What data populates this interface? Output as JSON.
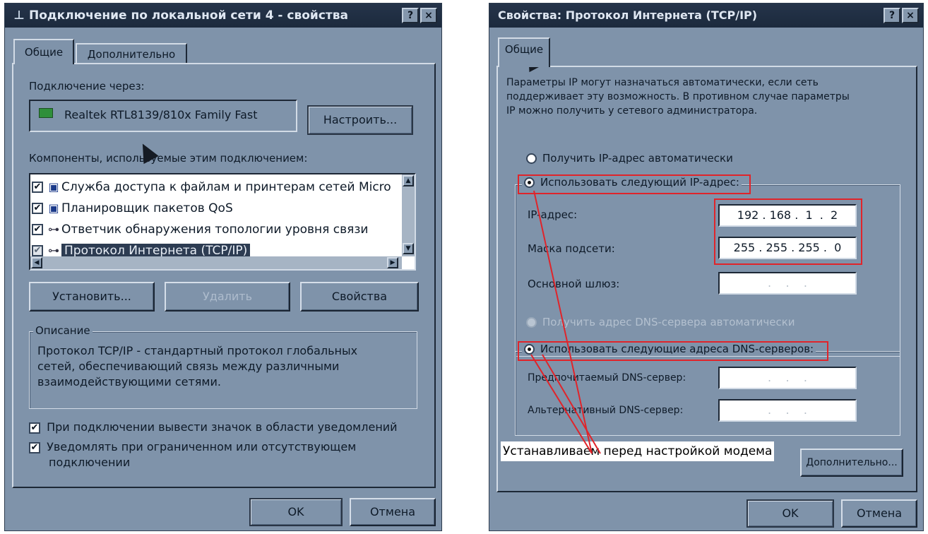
{
  "left_dialog": {
    "title": "Подключение по локальной сети 4 - свойства",
    "title_icon": "network-icon",
    "help_button": "?",
    "close_button": "×",
    "tabs": [
      {
        "label": "Общие"
      },
      {
        "label": "Дополнительно"
      }
    ],
    "connect_through_label": "Подключение через:",
    "adapter_name": "Realtek RTL8139/810x Family Fast",
    "adapter_icon": "network-card-icon",
    "configure_button": "Настроить...",
    "components_label": "Компоненты, используемые этим подключением:",
    "components": [
      {
        "label": "Служба доступа к файлам и принтерам сетей Micro",
        "checked": "✔",
        "icon": "computer-icon"
      },
      {
        "label": "Планировщик пакетов QoS",
        "checked": "✔",
        "icon": "computer-icon"
      },
      {
        "label": "Ответчик обнаружения топологии уровня связи",
        "checked": "✔",
        "icon": "protocol-icon"
      },
      {
        "label": "Протокол Интернета (TCP/IP)",
        "checked": "✔",
        "icon": "protocol-icon"
      }
    ],
    "install_button": "Установить...",
    "remove_button": "Удалить",
    "properties_button": "Свойства",
    "description_legend": "Описание",
    "description_text": [
      "Протокол TCP/IP - стандартный протокол глобальных",
      "сетей, обеспечивающий связь между различными",
      "взаимодействующими сетями."
    ],
    "show_icon_checkbox": "При подключении вывести значок в области уведомлений",
    "notify_checkbox_lines": [
      "Уведомлять при ограниченном или отсутствующем",
      "подключении"
    ],
    "checkbox_mark": "✔",
    "ok_button": "OK",
    "cancel_button": "Отмена"
  },
  "right_dialog": {
    "title": "Свойства: Протокол Интернета (TCP/IP)",
    "help_button": "?",
    "close_button": "×",
    "tab_label": "Общие",
    "intro_lines": [
      "Параметры IP могут назначаться автоматически, если сеть",
      "поддерживает эту возможность. В противном случае параметры",
      "IP можно получить у сетевого администратора."
    ],
    "radio_auto_ip": "Получить IP-адрес автоматически",
    "radio_manual_ip": "Использовать следующий IP-адрес:",
    "ip_label": "IP-адрес:",
    "ip_value": "192 . 168 .  1  .  2",
    "mask_label": "Маска подсети:",
    "mask_value": "255 . 255 . 255 .  0",
    "gateway_label": "Основной шлюз:",
    "empty_ip": " .    .    . ",
    "radio_auto_dns": "Получить адрес DNS-сервера автоматически",
    "radio_manual_dns": "Использовать следующие адреса DNS-серверов:",
    "preferred_dns_label": "Предпочитаемый DNS-сервер:",
    "alternate_dns_label": "Альтернативный DNS-сервер:",
    "annotation": "Устанавливаем перед настройкой модема",
    "advanced_button": "Дополнительно...",
    "ok_button": "OK",
    "cancel_button": "Отмена"
  },
  "colors": {
    "dialog_bg": "#7f93aa",
    "titlebar": "#1f2d40",
    "highlight_red": "#e0242a"
  }
}
